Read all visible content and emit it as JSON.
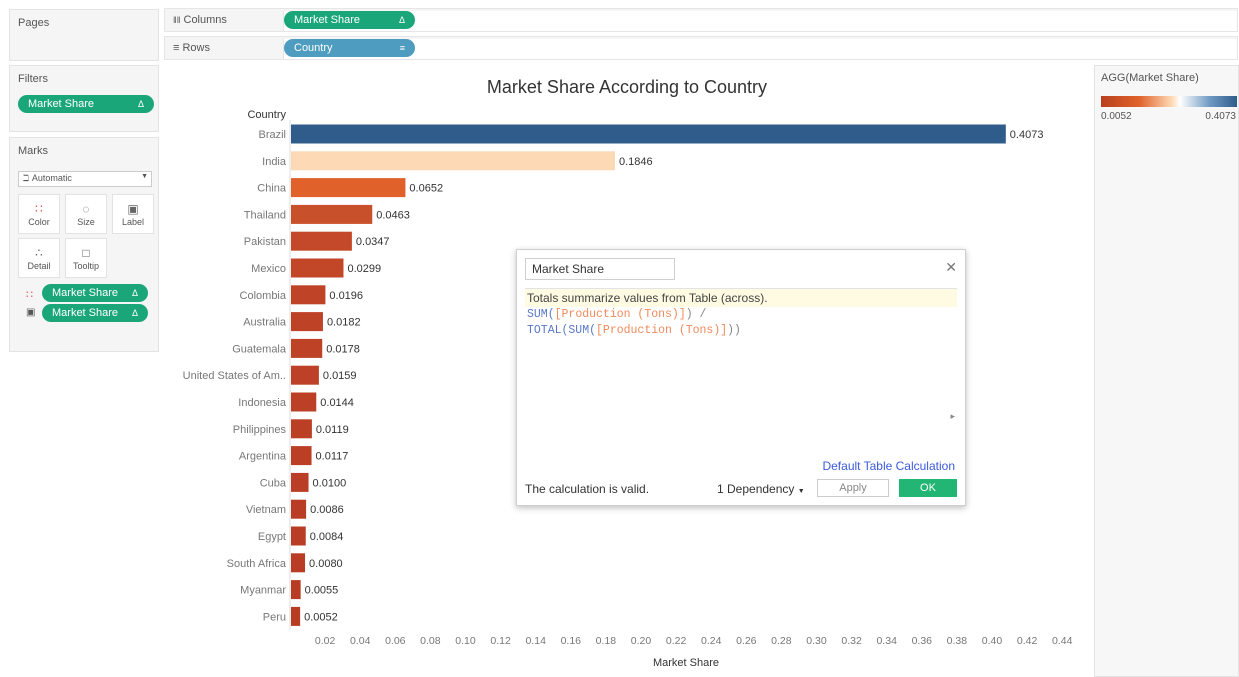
{
  "pages": {
    "title": "Pages"
  },
  "shelves": {
    "columns": {
      "label": "Columns",
      "pill": "Market Share",
      "pill_icon": "delta-icon"
    },
    "rows": {
      "label": "Rows",
      "pill": "Country",
      "pill_icon": "sort-descending-icon"
    }
  },
  "filters": {
    "title": "Filters",
    "pill": "Market Share"
  },
  "marks": {
    "title": "Marks",
    "type": "Automatic",
    "buttons": [
      "Color",
      "Size",
      "Label",
      "Detail",
      "Tooltip"
    ],
    "pills": [
      {
        "icon": "color-dots-icon",
        "label": "Market Share"
      },
      {
        "icon": "label-icon",
        "label": "Market Share"
      }
    ]
  },
  "legend": {
    "title": "AGG(Market Share)",
    "min": "0.0052",
    "max": "0.4073"
  },
  "colors": {
    "green": "#1ba67a",
    "blue": "#4e9cbf",
    "dark_blue": "#2f5c8a",
    "light_orange": "#fdd9b5",
    "orange": "#e0622a",
    "dark_orange": "#c0441f"
  },
  "chart_data": {
    "type": "bar",
    "title": "Market Share  According to Country",
    "ylabel": "Country",
    "xlabel": "Market Share",
    "xlim": [
      0,
      0.45
    ],
    "xticks": [
      "0.02",
      "0.04",
      "0.06",
      "0.08",
      "0.10",
      "0.12",
      "0.14",
      "0.16",
      "0.18",
      "0.20",
      "0.22",
      "0.24",
      "0.26",
      "0.28",
      "0.30",
      "0.32",
      "0.34",
      "0.36",
      "0.38",
      "0.40",
      "0.42",
      "0.44"
    ],
    "categories": [
      "Brazil",
      "India",
      "China",
      "Thailand",
      "Pakistan",
      "Mexico",
      "Colombia",
      "Australia",
      "Guatemala",
      "United States of Am..",
      "Indonesia",
      "Philippines",
      "Argentina",
      "Cuba",
      "Vietnam",
      "Egypt",
      "South Africa",
      "Myanmar",
      "Peru"
    ],
    "values": [
      0.4073,
      0.1846,
      0.0652,
      0.0463,
      0.0347,
      0.0299,
      0.0196,
      0.0182,
      0.0178,
      0.0159,
      0.0144,
      0.0119,
      0.0117,
      0.01,
      0.0086,
      0.0084,
      0.008,
      0.0055,
      0.0052
    ],
    "labels": [
      "0.4073",
      "0.1846",
      "0.0652",
      "0.0463",
      "0.0347",
      "0.0299",
      "0.0196",
      "0.0182",
      "0.0178",
      "0.0159",
      "0.0144",
      "0.0119",
      "0.0117",
      "0.0100",
      "0.0086",
      "0.0084",
      "0.0080",
      "0.0055",
      "0.0052"
    ],
    "bar_colors": [
      "#2f5c8a",
      "#fdd9b5",
      "#e0622a",
      "#c8502a",
      "#c4492a",
      "#c24628",
      "#bf4326",
      "#be4226",
      "#be4226",
      "#bd4126",
      "#bc4025",
      "#bb3f25",
      "#bb3f25",
      "#ba3e25",
      "#b93d24",
      "#b93d24",
      "#b93d24",
      "#b83c24",
      "#b83c24"
    ]
  },
  "dialog": {
    "name": "Market Share",
    "hint": "Totals summarize values from Table (across).",
    "code_line1_fn": "SUM(",
    "code_line1_field": "[Production (Tons)]",
    "code_line1_end": ") /",
    "code_line2_fn": "TOTAL(SUM(",
    "code_line2_field": "[Production (Tons)]",
    "code_line2_end": "))",
    "default_link": "Default Table Calculation",
    "status": "The calculation is valid.",
    "dependency": "1 Dependency",
    "apply": "Apply",
    "ok": "OK"
  }
}
